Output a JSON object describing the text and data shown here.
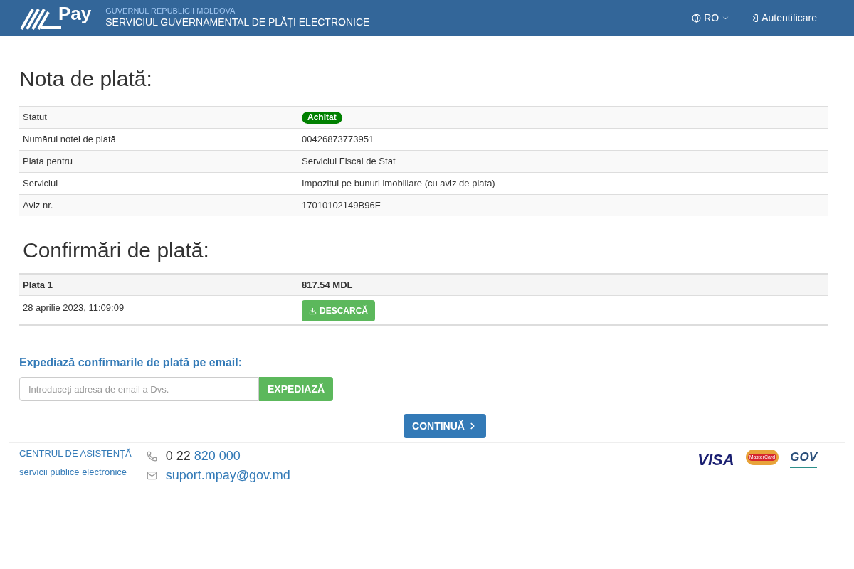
{
  "header": {
    "logo_text": "Pay",
    "org": "GUVERNUL REPUBLICII MOLDOVA",
    "service": "SERVICIUL GUVERNAMENTAL DE PLĂȚI ELECTRONICE",
    "language": "RO",
    "login": "Autentificare"
  },
  "invoice": {
    "title": "Nota de plată:",
    "rows": [
      {
        "label": "Statut",
        "value": "Achitat",
        "kind": "badge"
      },
      {
        "label": "Numărul notei de plată",
        "value": "00426873773951",
        "kind": "text"
      },
      {
        "label": "Plata pentru",
        "value": "Serviciul Fiscal de Stat",
        "kind": "text"
      },
      {
        "label": "Serviciul",
        "value": "Impozitul pe bunuri imobiliare (cu aviz de plata)",
        "kind": "text"
      },
      {
        "label": "Aviz nr.",
        "value": "17010102149B96F",
        "kind": "text"
      }
    ]
  },
  "confirmations": {
    "title": "Confirmări de plată:",
    "payments": [
      {
        "name": "Plată 1",
        "amount": "817.54 MDL",
        "date": "28 aprilie 2023, 11:09:09",
        "download": "DESCARCĂ"
      }
    ]
  },
  "email": {
    "title": "Expediază confirmarile de plată pe email:",
    "placeholder": "Introduceți adresa de email a Dvs.",
    "button": "EXPEDIAZĂ"
  },
  "continue": "CONTINUĂ",
  "footer": {
    "center": "CENTRUL DE ASISTENȚĂ",
    "subtitle": "servicii publice electronice",
    "phone_prefix": "0 22",
    "phone_number": "820 000",
    "email": "suport.mpay@gov.md",
    "logos": [
      "VISA",
      "MasterCard",
      "GOV"
    ]
  }
}
